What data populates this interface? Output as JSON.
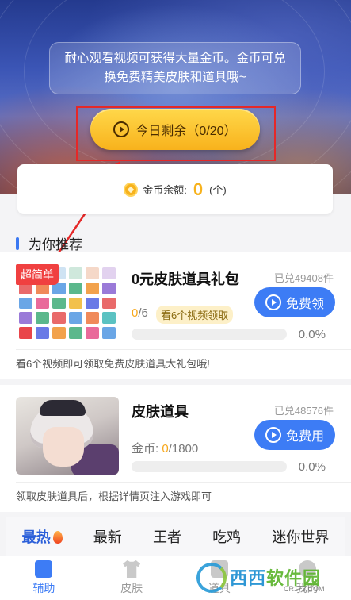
{
  "hero": {
    "message": "耐心观看视频可获得大量金币。金币可兑换免费精美皮肤和道具哦~",
    "today_button": "今日剩余（0/20）"
  },
  "coin_balance": {
    "label": "金币余额:",
    "value": "0",
    "unit": "(个)"
  },
  "section": {
    "title": "为你推荐"
  },
  "items": [
    {
      "tag": "超简单",
      "title": "0元皮肤道具礼包",
      "redeemed": "已兑49408件",
      "button": "免费领",
      "progress_current": "0",
      "progress_total": "/6",
      "video_tag": "看6个视频领取",
      "progress_fraction": 0,
      "percent": "0.0%",
      "description": "看6个视频即可领取免费皮肤道具大礼包哦!"
    },
    {
      "title": "皮肤道具",
      "redeemed": "已兑48576件",
      "button": "免费用",
      "coin_label": "金币: ",
      "progress_current": "0",
      "progress_total": "/1800",
      "progress_fraction": 0,
      "percent": "0.0%",
      "description": "领取皮肤道具后，根据详情页注入游戏即可"
    }
  ],
  "category_tabs": [
    "最热",
    "最新",
    "王者",
    "吃鸡",
    "迷你世界"
  ],
  "bottom_nav": [
    "辅助",
    "皮肤",
    "道具",
    "我的"
  ],
  "watermark": {
    "text_a": "西西",
    "text_b": "软件园",
    "url": "CR173.COM"
  },
  "colors": {
    "accent_blue": "#3d7cf5",
    "coin_gold": "#f7b21d",
    "highlight_red": "#e52828"
  }
}
